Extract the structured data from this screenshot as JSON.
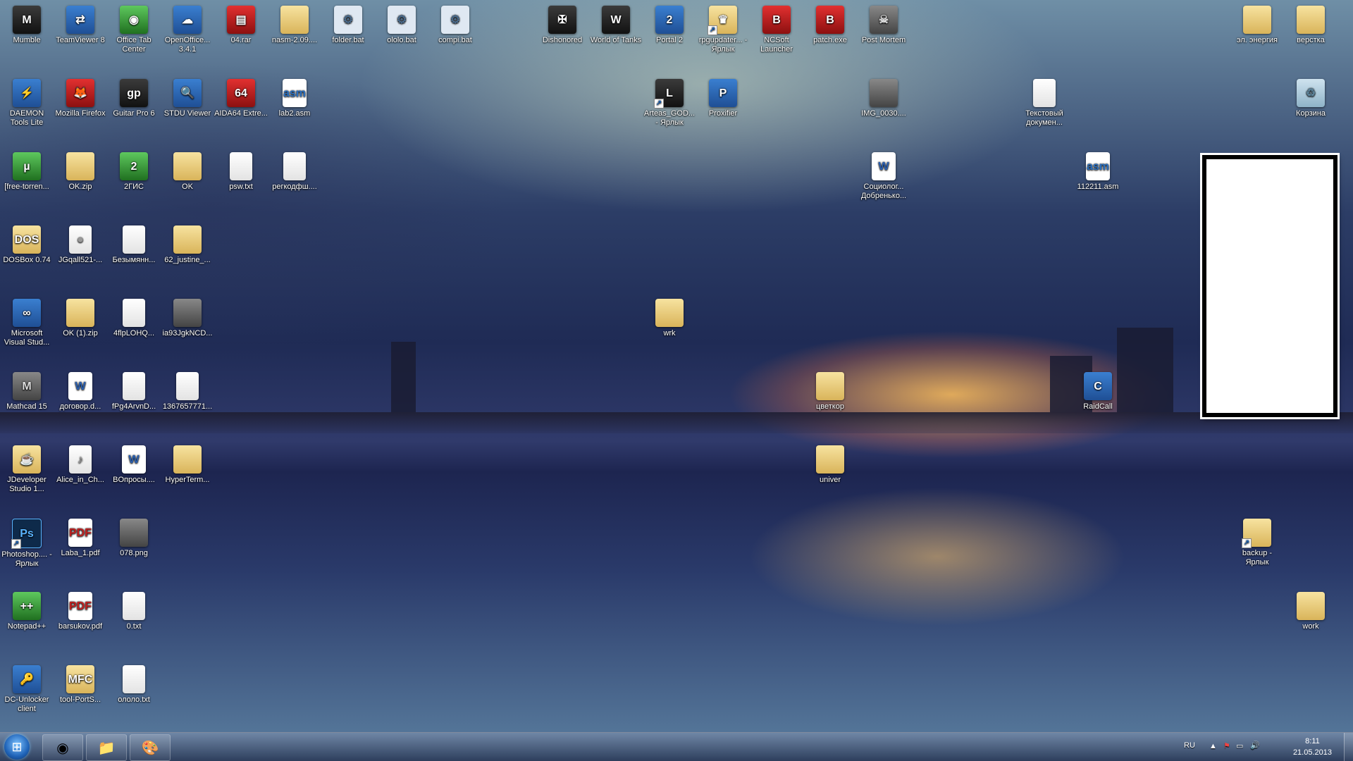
{
  "desktop": {
    "icons": [
      {
        "label": "Mumble",
        "icon": "mumble-icon",
        "glyph": "M",
        "style": "g-dark"
      },
      {
        "label": "TeamViewer 8",
        "icon": "teamviewer-icon",
        "glyph": "⇄",
        "style": "g-app"
      },
      {
        "label": "Office Tab Center",
        "icon": "office-tab-icon",
        "glyph": "◉",
        "style": "g-green"
      },
      {
        "label": "OpenOffice... 3.4.1",
        "icon": "openoffice-icon",
        "glyph": "☁",
        "style": "g-app"
      },
      {
        "label": "04.rar",
        "icon": "winrar-icon",
        "glyph": "▤",
        "style": "g-red"
      },
      {
        "label": "nasm-2.09....",
        "icon": "zip-folder-icon",
        "glyph": "",
        "style": "g-folder"
      },
      {
        "label": "folder.bat",
        "icon": "batch-file-icon",
        "glyph": "⚙",
        "style": "g-bat"
      },
      {
        "label": "ololo.bat",
        "icon": "batch-file-icon",
        "glyph": "⚙",
        "style": "g-bat"
      },
      {
        "label": "compi.bat",
        "icon": "batch-file-icon",
        "glyph": "⚙",
        "style": "g-bat"
      },
      {
        "label": "Dishonored",
        "icon": "dishonored-icon",
        "glyph": "✠",
        "style": "g-dark"
      },
      {
        "label": "World of Tanks",
        "icon": "world-of-tanks-icon",
        "glyph": "W",
        "style": "g-dark"
      },
      {
        "label": "Portal 2",
        "icon": "portal2-icon",
        "glyph": "2",
        "style": "g-app"
      },
      {
        "label": "rpgupdater... - Ярлык",
        "icon": "rpg-updater-icon",
        "glyph": "♛",
        "style": "g-folder"
      },
      {
        "label": "NCSoft Launcher",
        "icon": "ncsoft-icon",
        "glyph": "B",
        "style": "g-red"
      },
      {
        "label": "patch.exe",
        "icon": "patch-exe-icon",
        "glyph": "B",
        "style": "g-red"
      },
      {
        "label": "Post Mortem",
        "icon": "post-mortem-icon",
        "glyph": "☠",
        "style": "g-img"
      },
      {
        "label": "эл. энергия",
        "icon": "folder-icon",
        "glyph": "",
        "style": "g-folder"
      },
      {
        "label": "верстка",
        "icon": "folder-icon",
        "glyph": "",
        "style": "g-folder"
      },
      {
        "label": "DAEMON Tools Lite",
        "icon": "daemon-tools-icon",
        "glyph": "⚡",
        "style": "g-app"
      },
      {
        "label": "Mozilla Firefox",
        "icon": "firefox-icon",
        "glyph": "🦊",
        "style": "g-red"
      },
      {
        "label": "Guitar Pro 6",
        "icon": "guitar-pro-icon",
        "glyph": "gp",
        "style": "g-dark"
      },
      {
        "label": "STDU Viewer",
        "icon": "stdu-viewer-icon",
        "glyph": "🔍",
        "style": "g-app"
      },
      {
        "label": "AIDA64 Extre...",
        "icon": "aida64-icon",
        "glyph": "64",
        "style": "g-red"
      },
      {
        "label": "lab2.asm",
        "icon": "asm-file-icon",
        "glyph": "asm",
        "style": "g-asm"
      },
      {
        "label": "Arteas_GOD... - Ярлык",
        "icon": "lineage-icon",
        "glyph": "L",
        "style": "g-dark"
      },
      {
        "label": "Proxifier",
        "icon": "proxifier-icon",
        "glyph": "P",
        "style": "g-app"
      },
      {
        "label": "IMG_0030....",
        "icon": "image-file-icon",
        "glyph": "",
        "style": "g-img"
      },
      {
        "label": "Текстовый докумен...",
        "icon": "text-file-icon",
        "glyph": "",
        "style": "g-file"
      },
      {
        "label": "Корзина",
        "icon": "recycle-bin-icon",
        "glyph": "♻",
        "style": "g-trash"
      },
      {
        "label": "[free-torren...",
        "icon": "utorrent-icon",
        "glyph": "µ",
        "style": "g-green"
      },
      {
        "label": "OK.zip",
        "icon": "zip-folder-icon",
        "glyph": "",
        "style": "g-folder"
      },
      {
        "label": "2ГИС",
        "icon": "2gis-icon",
        "glyph": "2",
        "style": "g-green"
      },
      {
        "label": "OK",
        "icon": "folder-icon",
        "glyph": "",
        "style": "g-folder"
      },
      {
        "label": "psw.txt",
        "icon": "text-file-icon",
        "glyph": "",
        "style": "g-file"
      },
      {
        "label": "регкодфш....",
        "icon": "text-file-icon",
        "glyph": "",
        "style": "g-file"
      },
      {
        "label": "Социолог... Добренько...",
        "icon": "word-doc-icon",
        "glyph": "W",
        "style": "g-word"
      },
      {
        "label": "112211.asm",
        "icon": "asm-file-icon",
        "glyph": "asm",
        "style": "g-asm"
      },
      {
        "label": "DOSBox 0.74",
        "icon": "dosbox-icon",
        "glyph": "DOS",
        "style": "g-folder"
      },
      {
        "label": "JGqall521-...",
        "icon": "image-file-icon",
        "glyph": "●",
        "style": "g-file"
      },
      {
        "label": "Безымянн...",
        "icon": "image-file-icon",
        "glyph": "",
        "style": "g-file"
      },
      {
        "label": "62_justine_...",
        "icon": "folder-icon",
        "glyph": "",
        "style": "g-folder"
      },
      {
        "label": "Microsoft Visual Stud...",
        "icon": "visual-studio-icon",
        "glyph": "∞",
        "style": "g-app"
      },
      {
        "label": "OK (1).zip",
        "icon": "zip-folder-icon",
        "glyph": "",
        "style": "g-folder"
      },
      {
        "label": "4flpLOHQ...",
        "icon": "image-file-icon",
        "glyph": "",
        "style": "g-file"
      },
      {
        "label": "ia93JgkNCD...",
        "icon": "image-file-icon",
        "glyph": "",
        "style": "g-img"
      },
      {
        "label": "wrk",
        "icon": "zip-folder-icon",
        "glyph": "",
        "style": "g-folder"
      },
      {
        "label": "Mathcad 15",
        "icon": "mathcad-icon",
        "glyph": "M",
        "style": "g-img"
      },
      {
        "label": "договор.d...",
        "icon": "word-doc-icon",
        "glyph": "W",
        "style": "g-word"
      },
      {
        "label": "fPg4ArvnD...",
        "icon": "image-file-icon",
        "glyph": "",
        "style": "g-file"
      },
      {
        "label": "1367657771...",
        "icon": "image-file-icon",
        "glyph": "",
        "style": "g-file"
      },
      {
        "label": "цветкор",
        "icon": "folder-icon",
        "glyph": "",
        "style": "g-folder"
      },
      {
        "label": "RaidCall",
        "icon": "raidcall-icon",
        "glyph": "C",
        "style": "g-app"
      },
      {
        "label": "JDeveloper Studio 1...",
        "icon": "jdeveloper-icon",
        "glyph": "☕",
        "style": "g-folder"
      },
      {
        "label": "Alice_in_Ch...",
        "icon": "mp3-file-icon",
        "glyph": "♪",
        "style": "g-file"
      },
      {
        "label": "BOпросы....",
        "icon": "word-doc-icon",
        "glyph": "W",
        "style": "g-word"
      },
      {
        "label": "HyperTerm...",
        "icon": "folder-icon",
        "glyph": "",
        "style": "g-folder"
      },
      {
        "label": "univer",
        "icon": "folder-icon",
        "glyph": "",
        "style": "g-folder"
      },
      {
        "label": "Photoshop.... - Ярлык",
        "icon": "photoshop-icon",
        "glyph": "Ps",
        "style": "g-ps"
      },
      {
        "label": "Laba_1.pdf",
        "icon": "pdf-file-icon",
        "glyph": "PDF",
        "style": "g-pdf"
      },
      {
        "label": "078.png",
        "icon": "image-file-icon",
        "glyph": "",
        "style": "g-img"
      },
      {
        "label": "backup - Ярлык",
        "icon": "folder-shortcut-icon",
        "glyph": "",
        "style": "g-folder"
      },
      {
        "label": "Notepad++",
        "icon": "notepad-plus-icon",
        "glyph": "++",
        "style": "g-green"
      },
      {
        "label": "barsukov.pdf",
        "icon": "pdf-file-icon",
        "glyph": "PDF",
        "style": "g-pdf"
      },
      {
        "label": "0.txt",
        "icon": "text-file-icon",
        "glyph": "",
        "style": "g-file"
      },
      {
        "label": "work",
        "icon": "folder-icon",
        "glyph": "",
        "style": "g-folder"
      },
      {
        "label": "DC-Unlocker client",
        "icon": "dc-unlocker-icon",
        "glyph": "🔑",
        "style": "g-app"
      },
      {
        "label": "tool-PortS...",
        "icon": "tool-ports-icon",
        "glyph": "MFC",
        "style": "g-folder"
      },
      {
        "label": "ололо.txt",
        "icon": "text-file-icon",
        "glyph": "",
        "style": "g-file"
      }
    ]
  },
  "taskbar": {
    "start_glyph": "⊞",
    "pinned": [
      {
        "name": "chrome-button",
        "glyph": "◉"
      },
      {
        "name": "explorer-button",
        "glyph": "📁"
      },
      {
        "name": "paint-button",
        "glyph": "🎨"
      }
    ],
    "language": "RU",
    "time": "8:11",
    "date": "21.05.2013"
  }
}
